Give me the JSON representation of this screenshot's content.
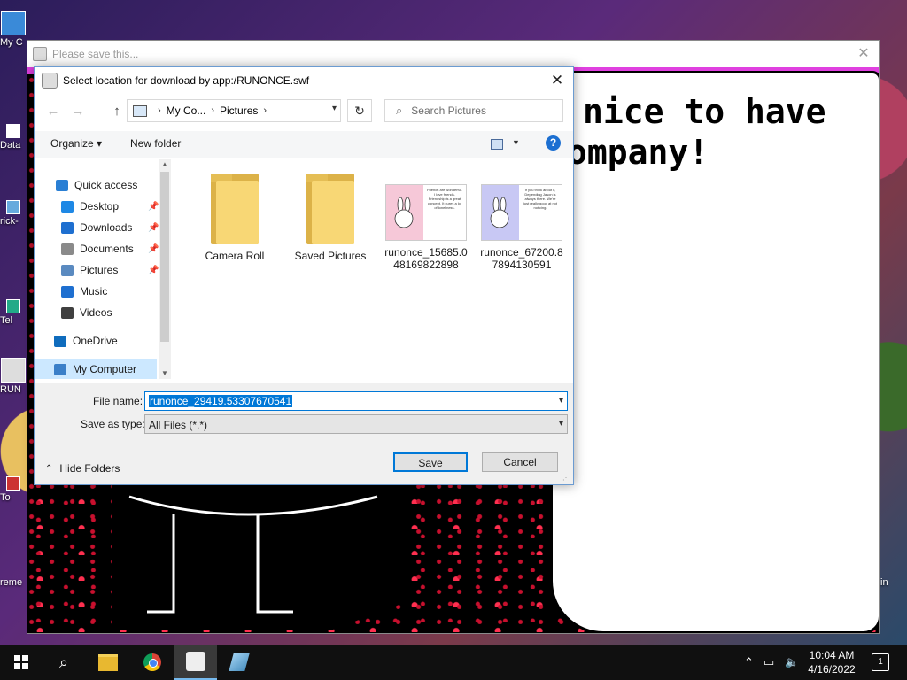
{
  "desktop": {
    "icons": [
      {
        "label": "My C"
      },
      {
        "label": "Data"
      },
      {
        "label": "rick-"
      },
      {
        "label": "Tel"
      },
      {
        "label": "RUN"
      },
      {
        "label": "To"
      },
      {
        "label": "reme"
      }
    ],
    "right_edge_label": "in"
  },
  "app_window": {
    "title": "Please save this...",
    "close_glyph": "✕",
    "speech_line1": "nice to have",
    "speech_line2": "ompany!"
  },
  "dialog": {
    "title": "Select location for download by app:/RUNONCE.swf",
    "close_glyph": "✕",
    "nav": {
      "back_glyph": "←",
      "forward_glyph": "→",
      "up_glyph": "↑",
      "breadcrumb": [
        "My Co...",
        "Pictures"
      ],
      "refresh_glyph": "↻",
      "search_placeholder": "Search Pictures"
    },
    "toolbar": {
      "organize": "Organize ▾",
      "new_folder": "New folder",
      "help": "?"
    },
    "nav_pane": [
      {
        "label": "Quick access",
        "icon": "star-icon",
        "color": "#2a7fd4",
        "pinned": false
      },
      {
        "label": "Desktop",
        "icon": "desktop-icon",
        "color": "#1e88e5",
        "pinned": true
      },
      {
        "label": "Downloads",
        "icon": "download-icon",
        "color": "#1e6fd0",
        "pinned": true
      },
      {
        "label": "Documents",
        "icon": "document-icon",
        "color": "#8a8a8a",
        "pinned": true
      },
      {
        "label": "Pictures",
        "icon": "pictures-icon",
        "color": "#5a8ac0",
        "pinned": true
      },
      {
        "label": "Music",
        "icon": "music-icon",
        "color": "#1e6fd0",
        "pinned": false
      },
      {
        "label": "Videos",
        "icon": "video-icon",
        "color": "#404040",
        "pinned": false
      },
      {
        "label": "OneDrive",
        "icon": "onedrive-icon",
        "color": "#0f6cbd",
        "pinned": false
      },
      {
        "label": "My Computer",
        "icon": "computer-icon",
        "color": "#3a7fc8",
        "pinned": false
      }
    ],
    "files": [
      {
        "name": "Camera Roll",
        "kind": "folder"
      },
      {
        "name": "Saved Pictures",
        "kind": "folder"
      },
      {
        "name": "runonce_15685.0 48169822898",
        "kind": "image",
        "bg": "#f6c8d8",
        "caption": "Friends are wonderful. I love friends. Friendship is a great concept. It cures a lot of loneliness."
      },
      {
        "name": "runonce_67200.8 7894130591",
        "kind": "image",
        "bg": "#c8c8f4",
        "caption": "If you think about it, Depending Jason is always there. We're just really good at not noticing."
      }
    ],
    "file_name_label": "File name:",
    "file_name_value": "runonce_29419.53307670541",
    "save_type_label": "Save as type:",
    "save_type_value": "All Files (*.*)",
    "hide_folders": "Hide Folders",
    "save_label": "Save",
    "cancel_label": "Cancel"
  },
  "taskbar": {
    "time": "10:04 AM",
    "date": "4/16/2022",
    "notifications": "1"
  }
}
